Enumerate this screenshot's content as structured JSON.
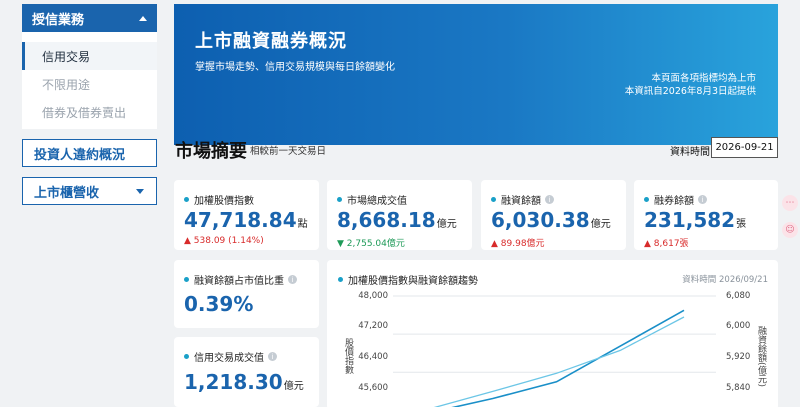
{
  "sidebar": {
    "menu_title": "授信業務",
    "sub_items": [
      "信用交易",
      "不限用途",
      "借券及借券賣出"
    ],
    "investor_btn": "投資人違約概況",
    "market_btn": "上市櫃營收"
  },
  "banner": {
    "title": "上市融資融券概況",
    "subtitle": "掌握市場走勢、信用交易規模與每日餘額變化",
    "note1": "本頁面各項指標均為上市",
    "note2": "本資訊自2026年8月3日起提供"
  },
  "summary": {
    "title": "市場摘要",
    "subtitle": "相較前一天交易日",
    "date_label": "資料時間",
    "date_value": "2026-09-21"
  },
  "cards": {
    "index": {
      "label": "加權股價指數",
      "value": "47,718.84",
      "unit": "點",
      "change": "▲ 538.09 (1.14%)",
      "dir": "up"
    },
    "turnover": {
      "label": "市場總成交值",
      "value": "8,668.18",
      "unit": "億元",
      "change": "▼ 2,755.04億元",
      "dir": "down"
    },
    "margin": {
      "label": "融資餘額",
      "value": "6,030.38",
      "unit": "億元",
      "change": "▲ 89.98億元",
      "dir": "up"
    },
    "short": {
      "label": "融券餘額",
      "value": "231,582",
      "unit": "張",
      "change": "▲ 8,617張",
      "dir": "up"
    },
    "ratio": {
      "label": "融資餘額占市值比重",
      "value": "0.39%"
    },
    "credit": {
      "label": "信用交易成交值",
      "value": "1,218.30",
      "unit": "億元"
    }
  },
  "chart_data": {
    "type": "line",
    "title": "加權股價指數與融資餘額趨勢",
    "date_note": "資料時間 2026/09/21",
    "ylabel_left": "股價指數",
    "ylabel_right": "融資餘額(億元)",
    "y_left_ticks": [
      "48,000",
      "47,200",
      "46,400",
      "45,600"
    ],
    "y_right_ticks": [
      "6,080",
      "6,000",
      "5,920",
      "5,840"
    ],
    "ylim_left": [
      45400,
      48000
    ],
    "ylim_right": [
      5820,
      6080
    ],
    "series": [
      {
        "axis": "left",
        "color": "#1a8fc8",
        "values": [
          45550,
          45850,
          46200,
          46950,
          47700
        ]
      },
      {
        "axis": "right",
        "color": "#6cc6e6",
        "values": [
          5843,
          5880,
          5918,
          5966,
          6036
        ]
      }
    ]
  },
  "colors": {
    "brand": "#1a64ad",
    "up": "#d82b2b",
    "down": "#1e9a58"
  }
}
